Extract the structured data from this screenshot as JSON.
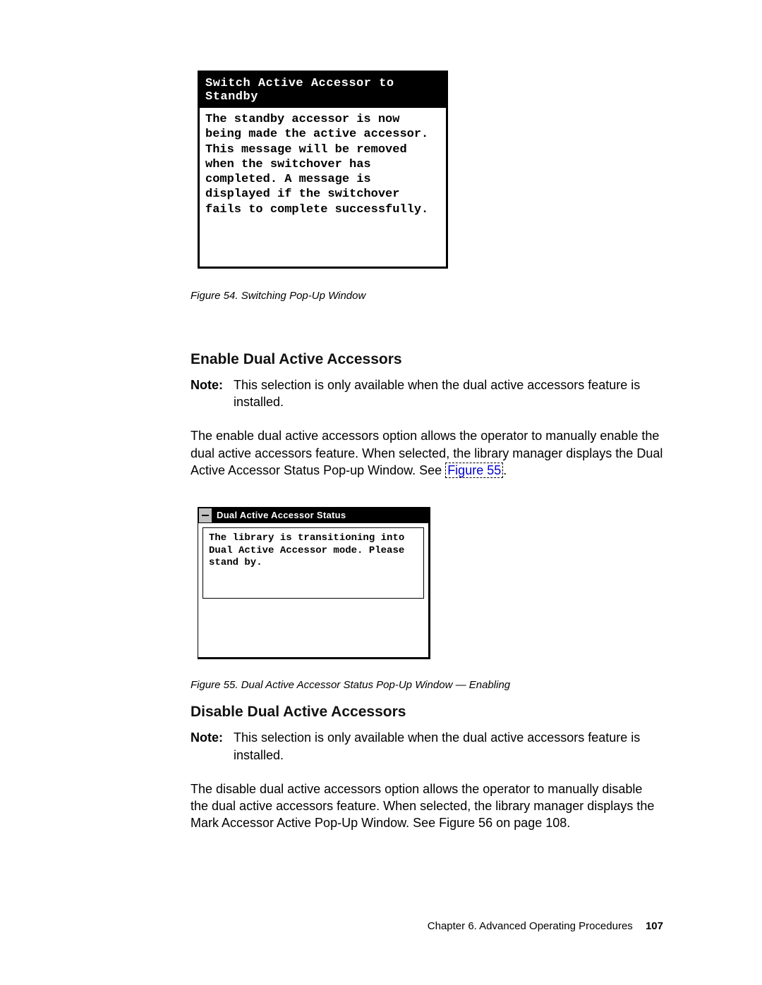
{
  "popup1": {
    "title": "Switch Active Accessor to Standby",
    "body": "The standby accessor is now being made the active accessor.\nThis message will be removed when the switchover has completed. A message is displayed if the switchover fails to complete successfully."
  },
  "fig54_caption": "Figure 54. Switching Pop-Up Window",
  "sectionA": {
    "heading": "Enable Dual Active Accessors",
    "note_label": "Note:",
    "note_text": "This selection is only available when the dual active accessors feature is installed.",
    "para_pre": "The enable dual active accessors option allows the operator to manually enable the dual active accessors feature. When selected, the library manager displays the Dual Active Accessor Status Pop-up Window. See ",
    "figref": "Figure 55",
    "para_post": "."
  },
  "popup2": {
    "title": "Dual Active Accessor Status",
    "body": "The library is transitioning into Dual Active Accessor mode. Please stand by."
  },
  "fig55_caption": "Figure 55. Dual Active Accessor Status Pop-Up Window — Enabling",
  "sectionB": {
    "heading": "Disable Dual Active Accessors",
    "note_label": "Note:",
    "note_text": "This selection is only available when the dual active accessors feature is installed.",
    "para": "The disable dual active accessors option allows the operator to manually disable the dual active accessors feature. When selected, the library manager displays the Mark Accessor Active Pop-Up Window. See Figure 56 on page 108."
  },
  "footer": {
    "chapter": "Chapter 6. Advanced Operating Procedures",
    "page": "107"
  }
}
